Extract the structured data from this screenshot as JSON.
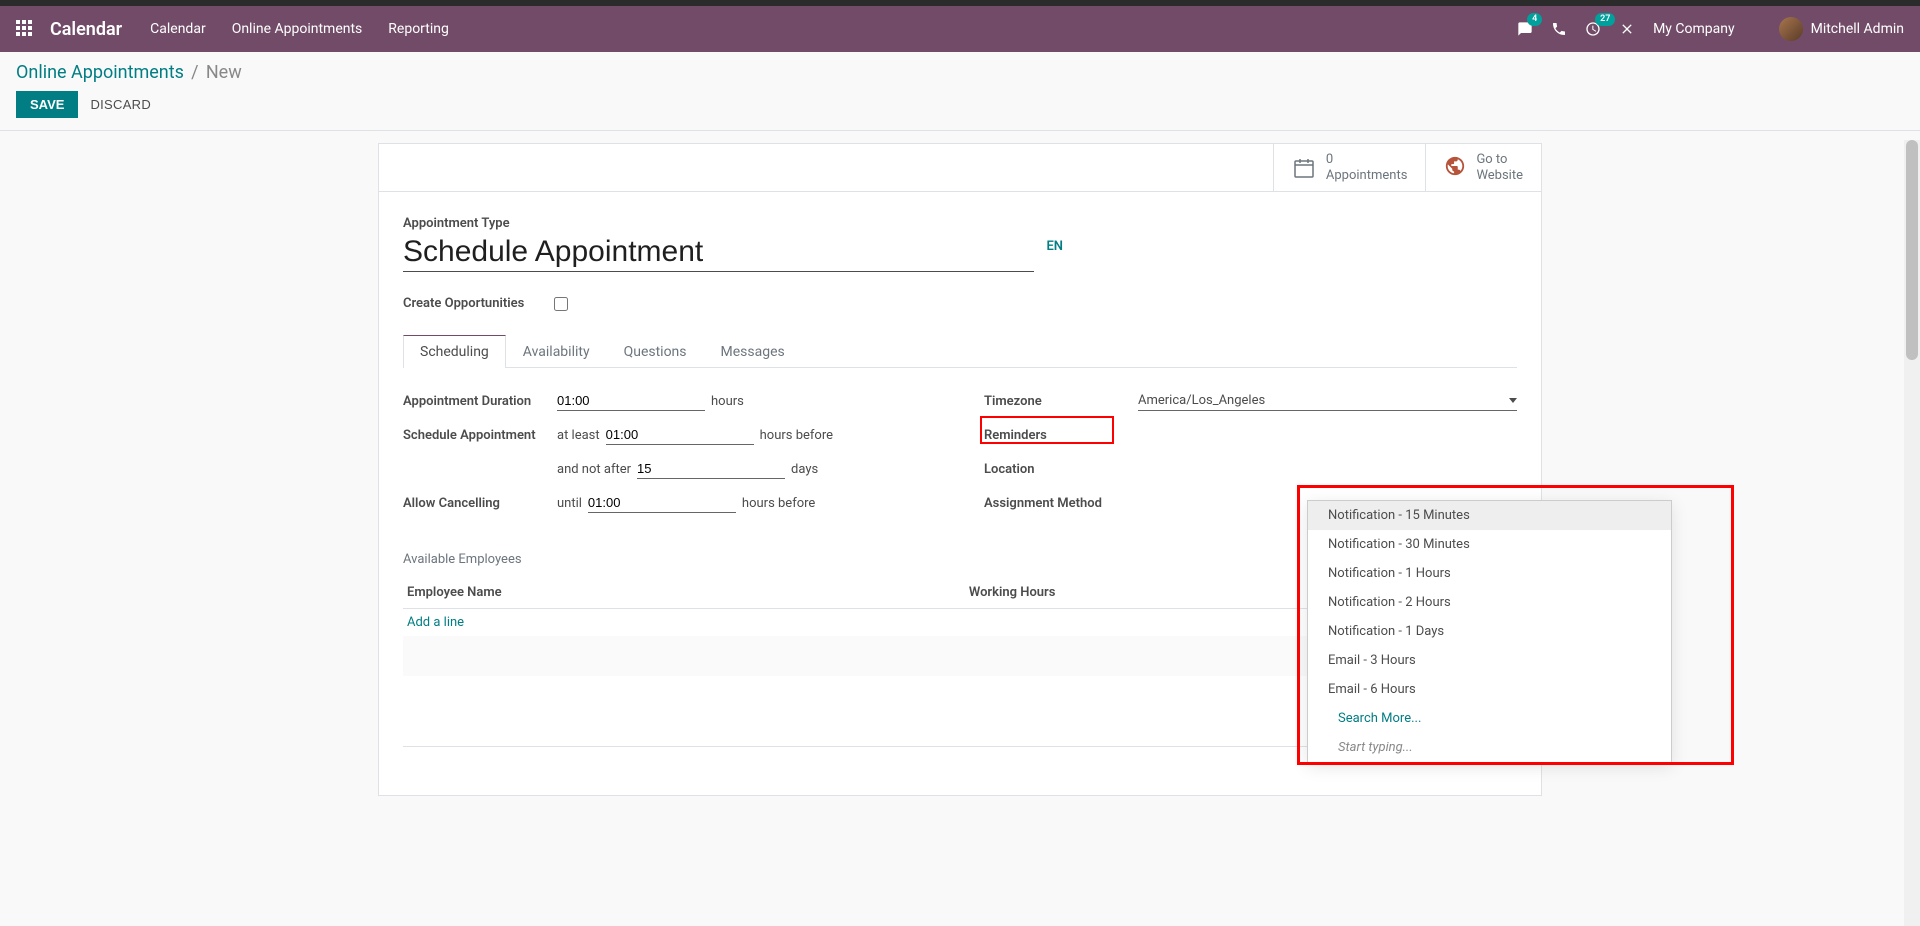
{
  "navbar": {
    "brand": "Calendar",
    "links": [
      "Calendar",
      "Online Appointments",
      "Reporting"
    ],
    "messages_badge": "4",
    "activities_badge": "27",
    "company": "My Company",
    "user": "Mitchell Admin"
  },
  "breadcrumb": {
    "parent": "Online Appointments",
    "current": "New"
  },
  "actions": {
    "save": "SAVE",
    "discard": "DISCARD"
  },
  "statbar": {
    "appointments_count": "0",
    "appointments_label": "Appointments",
    "goto": "Go to",
    "website": "Website"
  },
  "form": {
    "appointment_type_label": "Appointment Type",
    "title_value": "Schedule Appointment",
    "lang": "EN",
    "create_opportunities_label": "Create Opportunities"
  },
  "tabs": [
    "Scheduling",
    "Availability",
    "Questions",
    "Messages"
  ],
  "scheduling": {
    "duration_label": "Appointment Duration",
    "duration_value": "01:00",
    "duration_unit": "hours",
    "schedule_label": "Schedule Appointment",
    "at_least": "at least",
    "at_least_value": "01:00",
    "hours_before": "hours before",
    "and_not_after": "and not after",
    "not_after_value": "15",
    "days": "days",
    "allow_cancel_label": "Allow Cancelling",
    "until": "until",
    "until_value": "01:00",
    "timezone_label": "Timezone",
    "timezone_value": "America/Los_Angeles",
    "reminders_label": "Reminders",
    "location_label": "Location",
    "assignment_label": "Assignment Method"
  },
  "reminders_dropdown": {
    "options": [
      "Notification - 15 Minutes",
      "Notification - 30 Minutes",
      "Notification - 1 Hours",
      "Notification - 2 Hours",
      "Notification - 1 Days",
      "Email - 3 Hours",
      "Email - 6 Hours"
    ],
    "search_more": "Search More...",
    "start_typing": "Start typing..."
  },
  "employees": {
    "section": "Available Employees",
    "col_name": "Employee Name",
    "col_hours": "Working Hours",
    "add_line": "Add a line"
  }
}
